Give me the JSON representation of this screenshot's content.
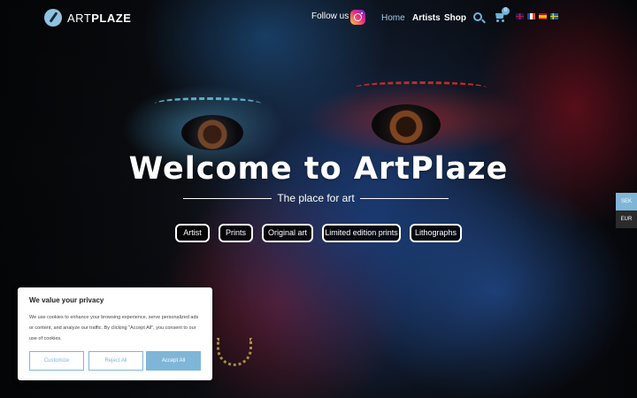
{
  "header": {
    "logo_light": "ART",
    "logo_bold": "PLAZE",
    "follow_text": "Follow us on",
    "nav": {
      "home": "Home",
      "artists": "Artists",
      "shop": "Shop"
    },
    "cart_count": "0",
    "languages": [
      "uk-flag",
      "fr-flag",
      "es-flag",
      "se-flag"
    ]
  },
  "hero": {
    "title": "Welcome to ArtPlaze",
    "subtitle": "The place for art",
    "categories": [
      "Artist",
      "Prints",
      "Original art",
      "Limited edition prints",
      "Lithographs"
    ]
  },
  "currency": {
    "options": [
      "SEK",
      "EUR"
    ],
    "selected": "SEK"
  },
  "cookie": {
    "title": "We value your privacy",
    "text": "We use cookies to enhance your browsing experience, serve personalized ads or content, and analyze our traffic. By clicking \"Accept All\", you consent to our use of cookies.",
    "buttons": {
      "customize": "Customize",
      "reject": "Reject All",
      "accept": "Accept All"
    }
  },
  "colors": {
    "accent": "#7fb6d8",
    "nav_active": "#9ecbe6"
  }
}
